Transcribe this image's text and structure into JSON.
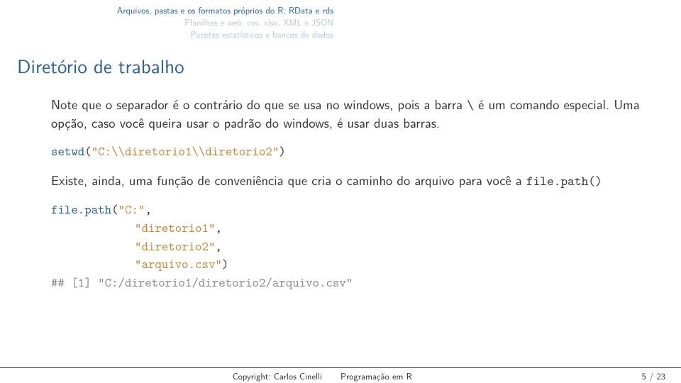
{
  "header": {
    "line1": "Arquivos, pastas e os formatos próprios do R: RData e rds",
    "line2": "Planilhas e web: csv, xlsx, XML e JSON",
    "line3": "Pacotes estatísticos e bancos de dados"
  },
  "title": "Diretório de trabalho",
  "body": {
    "p1a": "Note que o separador é o contrário do que se usa no windows, pois a barra ",
    "p1slash": "\\",
    "p1b": " é um comando especial. Uma opção, caso você queira usar o padrão do windows, é usar duas barras.",
    "code1_fn": "setwd",
    "code1_paren_open": "(",
    "code1_str": "\"C:\\\\diretorio1\\\\diretorio2\"",
    "code1_paren_close": ")",
    "p2a": "Existe, ainda, uma função de conveniência que cria o caminho do arquivo para você a ",
    "p2code": "file.path()",
    "code2_fn": "file.path",
    "code2_p_open": "(",
    "code2_arg1": "\"C:\"",
    "code2_comma": ",",
    "code2_arg2": "\"diretorio1\"",
    "code2_arg3": "\"diretorio2\"",
    "code2_arg4": "\"arquivo.csv\"",
    "code2_p_close": ")",
    "code2_out": "## [1] \"C:/diretorio1/diretorio2/arquivo.csv\""
  },
  "footer": {
    "copyright": "Copyright: Carlos Cinelli",
    "course": "Programação em R",
    "page": "5 / 23"
  }
}
